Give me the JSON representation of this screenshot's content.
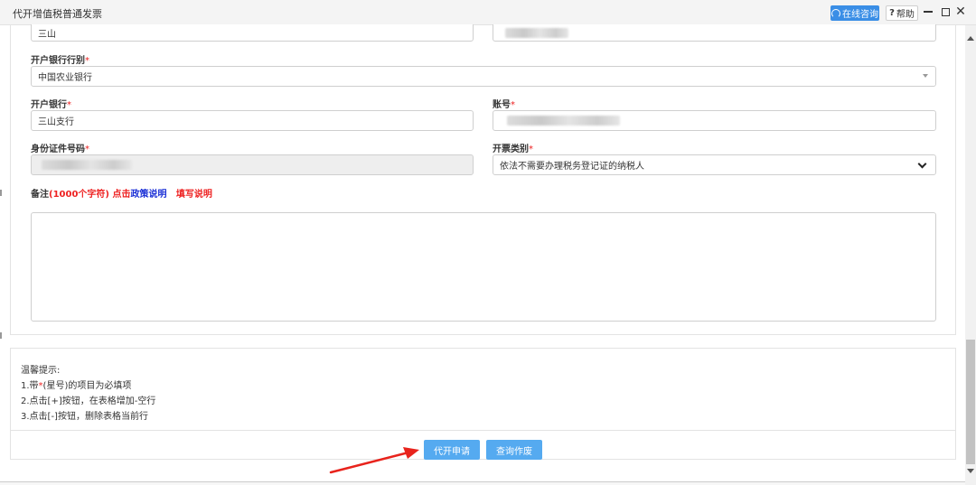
{
  "window": {
    "title": "代开增值税普通发票",
    "consult_label": "在线咨询",
    "help_label": "帮助"
  },
  "form": {
    "name_value": "三山",
    "bank_branch_type": {
      "label": "开户银行行别",
      "value": "中国农业银行"
    },
    "bank": {
      "label": "开户银行",
      "value": "三山支行"
    },
    "account": {
      "label": "账号"
    },
    "id_number": {
      "label": "身份证件号码"
    },
    "invoice_category": {
      "label": "开票类别",
      "value": "依法不需要办理税务登记证的纳税人"
    },
    "required_mark": "*",
    "remark": {
      "label": "备注",
      "limit": "(1000个字符)",
      "click_text": "点击",
      "policy_link": "政策说明",
      "fill_link": "填写说明"
    }
  },
  "tips": {
    "heading": "温馨提示:",
    "line1_prefix": "1.带",
    "line1_star": "*",
    "line1_suffix": "(星号)的项目为必填项",
    "line2": "2.点击[+]按钮，在表格增加-空行",
    "line3": "3.点击[-]按钮，删除表格当前行"
  },
  "actions": {
    "apply_label": "代开申请",
    "query_label": "查询作废"
  },
  "colors": {
    "primary_button": "#55aaf0",
    "consult_button": "#3a8ee6",
    "required": "#ee2222",
    "link_blue": "#1a2fd6",
    "annotation_arrow": "#e8231c"
  }
}
